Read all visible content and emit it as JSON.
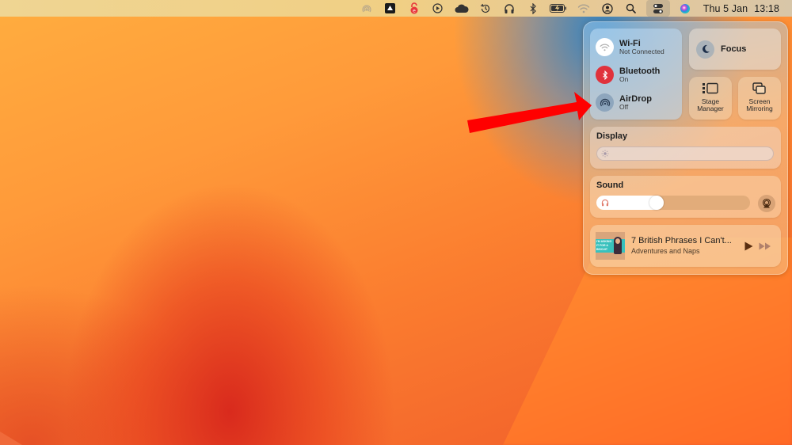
{
  "menubar": {
    "status_icons": [
      {
        "name": "airdrop-status-icon"
      },
      {
        "name": "google-drive-icon"
      },
      {
        "name": "security-app-icon"
      },
      {
        "name": "media-play-icon"
      },
      {
        "name": "cloud-icon"
      },
      {
        "name": "time-machine-icon"
      },
      {
        "name": "headphones-icon"
      },
      {
        "name": "bluetooth-icon"
      },
      {
        "name": "battery-charging-icon"
      },
      {
        "name": "wifi-icon"
      },
      {
        "name": "user-account-icon"
      },
      {
        "name": "spotlight-search-icon"
      },
      {
        "name": "control-center-icon"
      },
      {
        "name": "siri-icon"
      }
    ],
    "date": "Thu 5 Jan",
    "time": "13:18"
  },
  "control_center": {
    "connectivity": [
      {
        "id": "wifi",
        "label": "Wi-Fi",
        "status": "Not Connected",
        "icon": "wifi-icon",
        "active": false,
        "color": "#ffffff"
      },
      {
        "id": "bluetooth",
        "label": "Bluetooth",
        "status": "On",
        "icon": "bluetooth-icon",
        "active": true,
        "color": "#e0323c"
      },
      {
        "id": "airdrop",
        "label": "AirDrop",
        "status": "Off",
        "icon": "airdrop-icon",
        "active": false,
        "color": "#8ea6bd"
      }
    ],
    "focus": {
      "label": "Focus",
      "icon": "moon-icon"
    },
    "stage_manager": {
      "label_line1": "Stage",
      "label_line2": "Manager"
    },
    "screen_mirroring": {
      "label_line1": "Screen",
      "label_line2": "Mirroring"
    },
    "display": {
      "title": "Display",
      "brightness": 0.0
    },
    "sound": {
      "title": "Sound",
      "volume": 0.38,
      "output_icon": "headphones-icon"
    },
    "now_playing": {
      "title": "7 British Phrases I Can't...",
      "artist": "Adventures and Naps",
      "artwork_text": "I'M ASKING IT FOR A BISCUIT",
      "state": "paused"
    }
  },
  "annotation": {
    "type": "arrow",
    "color": "#ff0000",
    "points_to": "AirDrop"
  }
}
